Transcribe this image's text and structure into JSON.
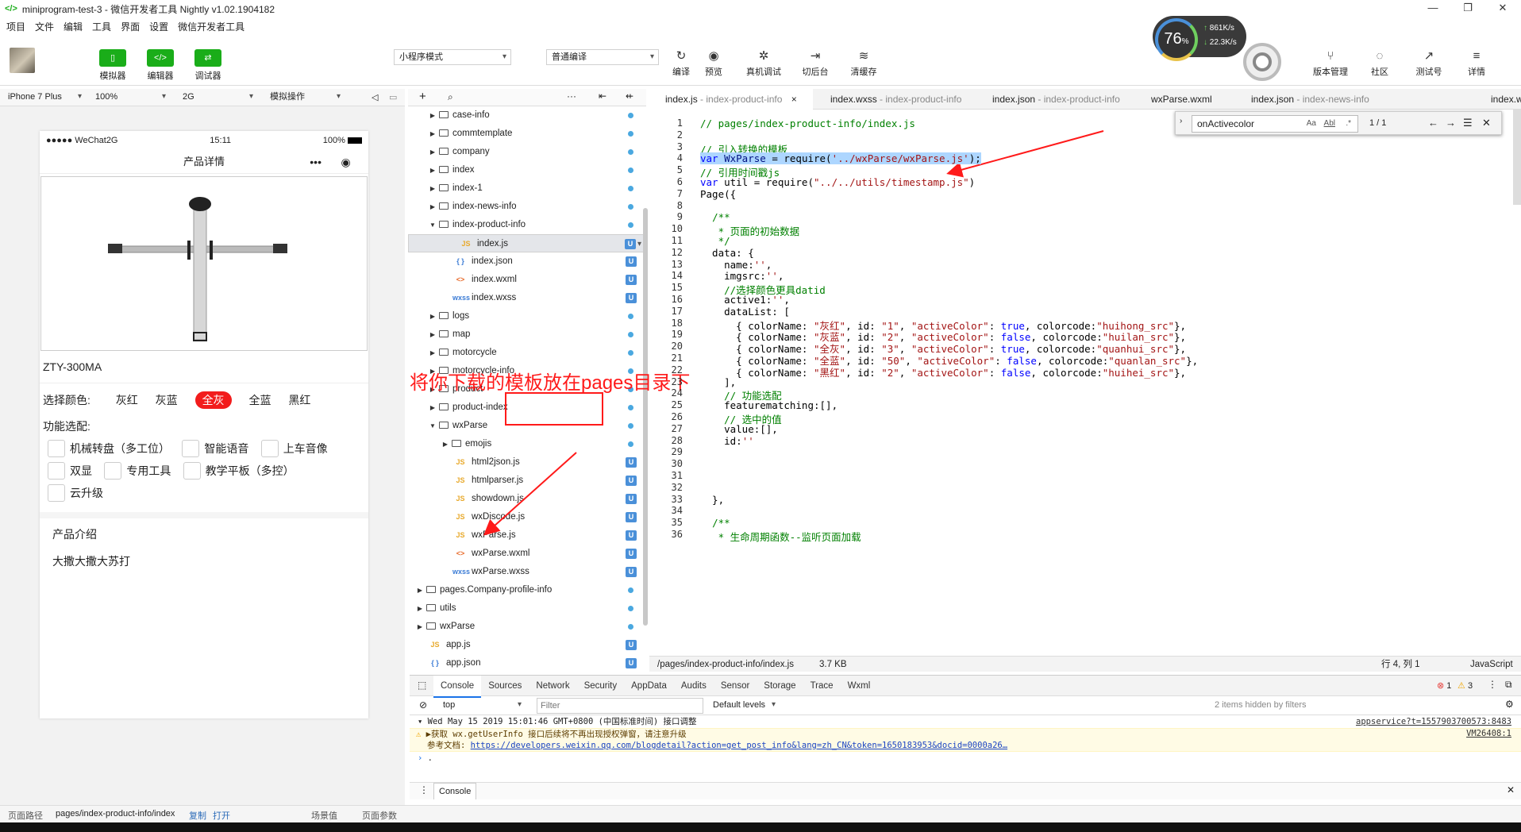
{
  "window": {
    "title": "miniprogram-test-3 - 微信开发者工具 Nightly v1.02.1904182",
    "controls": [
      "—",
      "❐",
      "✕"
    ]
  },
  "menu": [
    "项目",
    "文件",
    "编辑",
    "工具",
    "界面",
    "设置",
    "微信开发者工具"
  ],
  "toolbar": {
    "modes": [
      {
        "label": "模拟器",
        "icon": "▯"
      },
      {
        "label": "编辑器",
        "icon": "</>"
      },
      {
        "label": "调试器",
        "icon": "⇄"
      }
    ],
    "mode_select": "小程序模式",
    "compile_select": "普通编译",
    "actions": [
      {
        "label": "编译",
        "icon": "↻"
      },
      {
        "label": "预览",
        "icon": "◉"
      },
      {
        "label": "真机调试",
        "icon": "✲"
      },
      {
        "label": "切后台",
        "icon": "⇥"
      },
      {
        "label": "清缓存",
        "icon": "≋"
      }
    ],
    "right_actions": [
      {
        "label": "版本管理",
        "icon": "⑂"
      },
      {
        "label": "社区",
        "icon": "◌"
      },
      {
        "label": "测试号",
        "icon": "↗"
      },
      {
        "label": "详情",
        "icon": "≡"
      }
    ],
    "perf": {
      "percent": "76",
      "unit": "%",
      "up": "861K/s",
      "down": "22.3K/s"
    }
  },
  "simbar": {
    "device": "iPhone 7 Plus",
    "zoom": "100%",
    "network": "2G",
    "op": "模拟操作"
  },
  "phone": {
    "carrier": "●●●●● WeChat2G",
    "time": "15:11",
    "battery": "100%",
    "nav_title": "产品详情",
    "capsule": [
      "•••",
      "◉"
    ],
    "product_name": "ZTY-300MA",
    "color_label": "选择颜色:",
    "colors": [
      "灰红",
      "灰蓝",
      "全灰",
      "全蓝",
      "黑红"
    ],
    "color_active": "全灰",
    "feature_label": "功能选配:",
    "features": [
      [
        "机械转盘（多工位）",
        "智能语音",
        "上车音像"
      ],
      [
        "双显",
        "专用工具",
        "教学平板（多控）"
      ],
      [
        "云升级"
      ]
    ],
    "intro_title": "产品介绍",
    "intro_text": "大撒大撒大苏打"
  },
  "tree": {
    "items": [
      {
        "d": 1,
        "t": "folder",
        "n": "case-info",
        "m": "dot"
      },
      {
        "d": 1,
        "t": "folder",
        "n": "commtemplate",
        "m": "dot"
      },
      {
        "d": 1,
        "t": "folder",
        "n": "company",
        "m": "dot"
      },
      {
        "d": 1,
        "t": "folder",
        "n": "index",
        "m": "dot"
      },
      {
        "d": 1,
        "t": "folder",
        "n": "index-1",
        "m": "dot"
      },
      {
        "d": 1,
        "t": "folder",
        "n": "index-news-info",
        "m": "dot"
      },
      {
        "d": 1,
        "t": "open",
        "n": "index-product-info",
        "m": "dot"
      },
      {
        "d": 2,
        "t": "JS",
        "n": "index.js",
        "m": "U",
        "sel": true
      },
      {
        "d": 2,
        "t": "{ }",
        "n": "index.json",
        "m": "U"
      },
      {
        "d": 2,
        "t": "<>",
        "n": "index.wxml",
        "m": "U"
      },
      {
        "d": 2,
        "t": "wxss",
        "n": "index.wxss",
        "m": "U"
      },
      {
        "d": 1,
        "t": "folder",
        "n": "logs",
        "m": "dot"
      },
      {
        "d": 1,
        "t": "folder",
        "n": "map",
        "m": "dot"
      },
      {
        "d": 1,
        "t": "folder",
        "n": "motorcycle",
        "m": "dot"
      },
      {
        "d": 1,
        "t": "folder",
        "n": "motorcycle-info",
        "m": "dot"
      },
      {
        "d": 1,
        "t": "folder",
        "n": "product",
        "m": "dot"
      },
      {
        "d": 1,
        "t": "folder",
        "n": "product-index",
        "m": "dot"
      },
      {
        "d": 1,
        "t": "open",
        "n": "wxParse",
        "m": "dot"
      },
      {
        "d": 2,
        "t": "folder",
        "n": "emojis",
        "m": "dot"
      },
      {
        "d": 2,
        "t": "JS",
        "n": "html2json.js",
        "m": "U"
      },
      {
        "d": 2,
        "t": "JS",
        "n": "htmlparser.js",
        "m": "U"
      },
      {
        "d": 2,
        "t": "JS",
        "n": "showdown.js",
        "m": "U"
      },
      {
        "d": 2,
        "t": "JS",
        "n": "wxDiscode.js",
        "m": "U"
      },
      {
        "d": 2,
        "t": "JS",
        "n": "wxParse.js",
        "m": "U"
      },
      {
        "d": 2,
        "t": "<>",
        "n": "wxParse.wxml",
        "m": "U"
      },
      {
        "d": 2,
        "t": "wxss",
        "n": "wxParse.wxss",
        "m": "U"
      },
      {
        "d": 0,
        "t": "folder",
        "n": "pages.Company-profile-info",
        "m": "dot"
      },
      {
        "d": 0,
        "t": "folder",
        "n": "utils",
        "m": "dot"
      },
      {
        "d": 0,
        "t": "folder",
        "n": "wxParse",
        "m": "dot"
      },
      {
        "d": 0,
        "t": "JS",
        "n": "app.js",
        "m": "U"
      },
      {
        "d": 0,
        "t": "{ }",
        "n": "app.json",
        "m": "U"
      }
    ]
  },
  "tabs": [
    {
      "name": "index.js",
      "dir": " - index-product-info",
      "active": true
    },
    {
      "name": "index.wxss",
      "dir": " - index-product-info"
    },
    {
      "name": "index.json",
      "dir": " - index-product-info"
    },
    {
      "name": "wxParse.wxml",
      "dir": ""
    },
    {
      "name": "index.json",
      "dir": " - index-news-info"
    },
    {
      "name": "index.wxss",
      "dir": ""
    }
  ],
  "find": {
    "value": "onActivecolor",
    "count": "1 / 1",
    "opts": [
      "Aa",
      "Abl",
      ".*"
    ],
    "btns": [
      "←",
      "→",
      "☰",
      "✕"
    ]
  },
  "code": [
    "<span class='c'>// pages/index-product-info/index.js</span>",
    "",
    "<span class='c'>// 引入转换的模板</span>",
    "<span style='background:#add6ff'><span class='k'>var</span> <span class='p'>WxParse</span> = require(<span class='s'>'../wxParse/wxParse.js'</span>);</span>",
    "<span class='c'>// 引用时间戳js</span>",
    "<span class='k'>var</span> util = require(<span class='s'>\"../../utils/timestamp.js\"</span>)",
    "Page({",
    "",
    "  <span class='c'>/**</span>",
    "<span class='c'>   * 页面的初始数据</span>",
    "<span class='c'>   */</span>",
    "  data: {",
    "    name:<span class='s'>''</span>,",
    "    imgsrc:<span class='s'>''</span>,",
    "    <span class='c'>//选择颜色更具datid</span>",
    "    active1:<span class='s'>''</span>,",
    "    dataList: [",
    "      { colorName: <span class='s'>\"灰红\"</span>, id: <span class='s'>\"1\"</span>, <span class='s'>\"activeColor\"</span>: <span class='k'>true</span>, colorcode:<span class='s'>\"huihong_src\"</span>},",
    "      { colorName: <span class='s'>\"灰蓝\"</span>, id: <span class='s'>\"2\"</span>, <span class='s'>\"activeColor\"</span>: <span class='k'>false</span>, colorcode:<span class='s'>\"huilan_src\"</span>},",
    "      { colorName: <span class='s'>\"全灰\"</span>, id: <span class='s'>\"3\"</span>, <span class='s'>\"activeColor\"</span>: <span class='k'>true</span>, colorcode:<span class='s'>\"quanhui_src\"</span>},",
    "      { colorName: <span class='s'>\"全蓝\"</span>, id: <span class='s'>\"50\"</span>, <span class='s'>\"activeColor\"</span>: <span class='k'>false</span>, colorcode:<span class='s'>\"quanlan_src\"</span>},",
    "      { colorName: <span class='s'>\"黑红\"</span>, id: <span class='s'>\"2\"</span>, <span class='s'>\"activeColor\"</span>: <span class='k'>false</span>, colorcode:<span class='s'>\"huihei_src\"</span>},",
    "    ],",
    "    <span class='c'>// 功能选配</span>",
    "    featurematching:[],",
    "    <span class='c'>// 选中的值</span>",
    "    value:[],",
    "    id:<span class='s'>''</span>",
    "",
    "",
    "",
    "",
    "  },",
    "",
    "  <span class='c'>/**</span>",
    "<span class='c'>   * 生命周期函数--监听页面加载</span>"
  ],
  "editor_status": {
    "path": "/pages/index-product-info/index.js",
    "size": "3.7 KB",
    "pos": "行 4, 列 1",
    "lang": "JavaScript"
  },
  "console": {
    "tabs": [
      "Console",
      "Sources",
      "Network",
      "Security",
      "AppData",
      "Audits",
      "Sensor",
      "Storage",
      "Trace",
      "Wxml"
    ],
    "context": "top",
    "filter_placeholder": "Filter",
    "levels": "Default levels",
    "hidden": "2 items hidden by filters",
    "errors": "1",
    "warnings": "3",
    "log_time": "Wed May 15 2019 15:01:46 GMT+0800 (中国标准时间) 接口调整",
    "log_time_src": "appservice?t=1557903700573:8483",
    "warn1": "▶获取 wx.getUserInfo 接口后续将不再出现授权弹窗，请注意升级",
    "warn2_label": "参考文档:",
    "warn2_link": "https://developers.weixin.qq.com/blogdetail?action=get_post_info&lang=zh_CN&token=1650183953&docid=0000a26…",
    "warn_src": "VM26408:1",
    "prompt": ".",
    "drawer_tab": "Console"
  },
  "bottom": {
    "label": "页面路径",
    "path": "pages/index-product-info/index",
    "copy": "复制",
    "open": "打开",
    "scene": "场景值",
    "params": "页面参数"
  },
  "annotation": "将你下载的模板放在pages目录下"
}
